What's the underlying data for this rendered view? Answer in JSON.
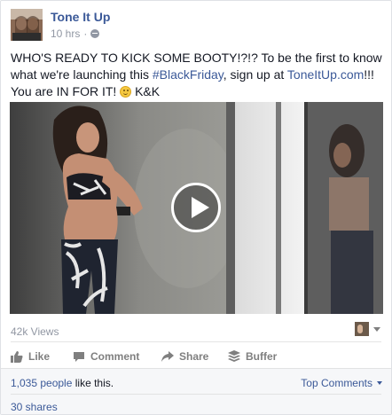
{
  "post": {
    "page_name": "Tone It Up",
    "time": "10 hrs",
    "separator": "·",
    "text_part1": "WHO'S READY TO KICK SOME BOOTY!?!? To be the first to know what we're launching this ",
    "hashtag": "#BlackFriday",
    "text_part2": ", sign up at ",
    "site_link": "ToneItUp.com",
    "text_part3": "!!! You are IN FOR IT! ",
    "text_part4": " K&K"
  },
  "video": {
    "views": "42k Views",
    "play_icon": "play-icon"
  },
  "actions": {
    "like": "Like",
    "comment": "Comment",
    "share": "Share",
    "buffer": "Buffer"
  },
  "social": {
    "likes_count": "1,035 people",
    "likes_suffix": " like this.",
    "top_comments": "Top Comments",
    "shares": "30 shares"
  },
  "colors": {
    "link": "#3b5998",
    "muted": "#9197a3",
    "text": "#141823"
  }
}
